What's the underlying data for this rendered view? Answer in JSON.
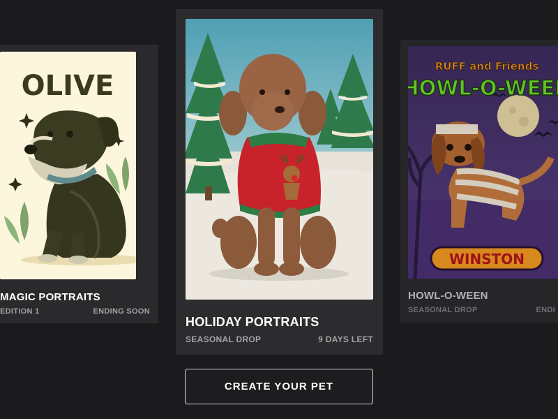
{
  "cards": [
    {
      "title": "MAGIC PORTRAITS",
      "meta_left": "EDITION 1",
      "meta_right": "ENDING SOON",
      "art_text": "OLIVE"
    },
    {
      "title": "HOLIDAY PORTRAITS",
      "meta_left": "SEASONAL DROP",
      "meta_right": "9 DAYS LEFT"
    },
    {
      "title": "HOWL-O-WEEN",
      "meta_left": "SEASONAL DROP",
      "meta_right": "ENDI",
      "art_top": "RUFF and Friends",
      "art_title": "HOWL-O-WEEN",
      "art_name": "WINSTON"
    }
  ],
  "cta": {
    "label": "CREATE YOUR PET"
  },
  "colors": {
    "background": "#1b1b1d",
    "card": "#2a2a2c",
    "muted_text": "#a3a3a6",
    "howl_green": "#6fdc2a",
    "winston_orange": "#f39a1f"
  }
}
